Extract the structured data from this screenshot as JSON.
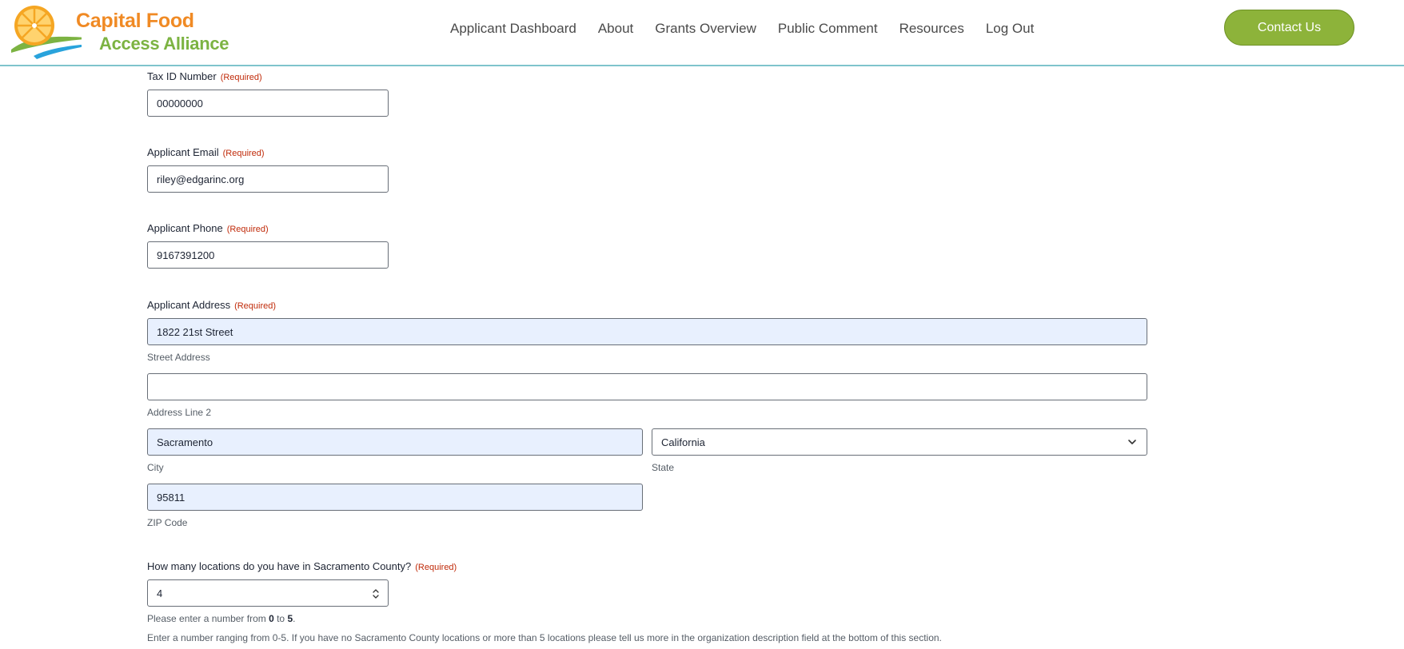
{
  "header": {
    "logo_line1": "Capital Food",
    "logo_line2": "Access Alliance",
    "nav": [
      "Applicant Dashboard",
      "About",
      "Grants Overview",
      "Public Comment",
      "Resources",
      "Log Out"
    ],
    "contact_label": "Contact Us"
  },
  "colors": {
    "brand_orange": "#f08a24",
    "brand_green": "#7cb342",
    "contact_button": "#8db33a",
    "header_border": "#7fc4cc",
    "required": "#c02b0a",
    "autofill_bg": "#e8f0fe"
  },
  "form": {
    "required_text": "(Required)",
    "tax_id": {
      "label": "Tax ID Number",
      "value": "00000000"
    },
    "email": {
      "label": "Applicant Email",
      "value": "riley@edgarinc.org"
    },
    "phone": {
      "label": "Applicant Phone",
      "value": "9167391200"
    },
    "address": {
      "label": "Applicant Address",
      "street": {
        "value": "1822 21st Street",
        "sublabel": "Street Address"
      },
      "line2": {
        "value": "",
        "sublabel": "Address Line 2"
      },
      "city": {
        "value": "Sacramento",
        "sublabel": "City"
      },
      "state": {
        "value": "California",
        "sublabel": "State"
      },
      "zip": {
        "value": "95811",
        "sublabel": "ZIP Code"
      }
    },
    "locations": {
      "label": "How many locations do you have in Sacramento County?",
      "value": "4",
      "range_prefix": "Please enter a number from ",
      "range_min": "0",
      "range_mid": " to ",
      "range_max": "5",
      "range_suffix": ".",
      "description": "Enter a number ranging from 0-5. If you have no Sacramento County locations or more than 5 locations please tell us more in the organization description field at the bottom of this section."
    }
  },
  "icons": {
    "logo": "orange-slice-logo-icon",
    "state_dropdown": "chevron-down-icon",
    "number_stepper": "stepper-arrows-icon"
  }
}
